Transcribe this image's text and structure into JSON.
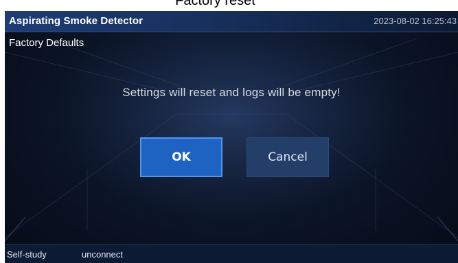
{
  "caption": "Factory reset",
  "header": {
    "title": "Aspirating Smoke Detector",
    "datetime": "2023-08-02  16:25:43"
  },
  "page": {
    "title": "Factory Defaults"
  },
  "dialog": {
    "message": "Settings will reset and logs will be empty!",
    "ok_label": "OK",
    "cancel_label": "Cancel"
  },
  "status_bar": {
    "mode": "Self-study",
    "connection": "unconnect"
  },
  "colors": {
    "header_bg": "#1e3d75",
    "ok_button": "#1f63c2",
    "cancel_button": "#243e6a",
    "background": "#0b1426"
  }
}
